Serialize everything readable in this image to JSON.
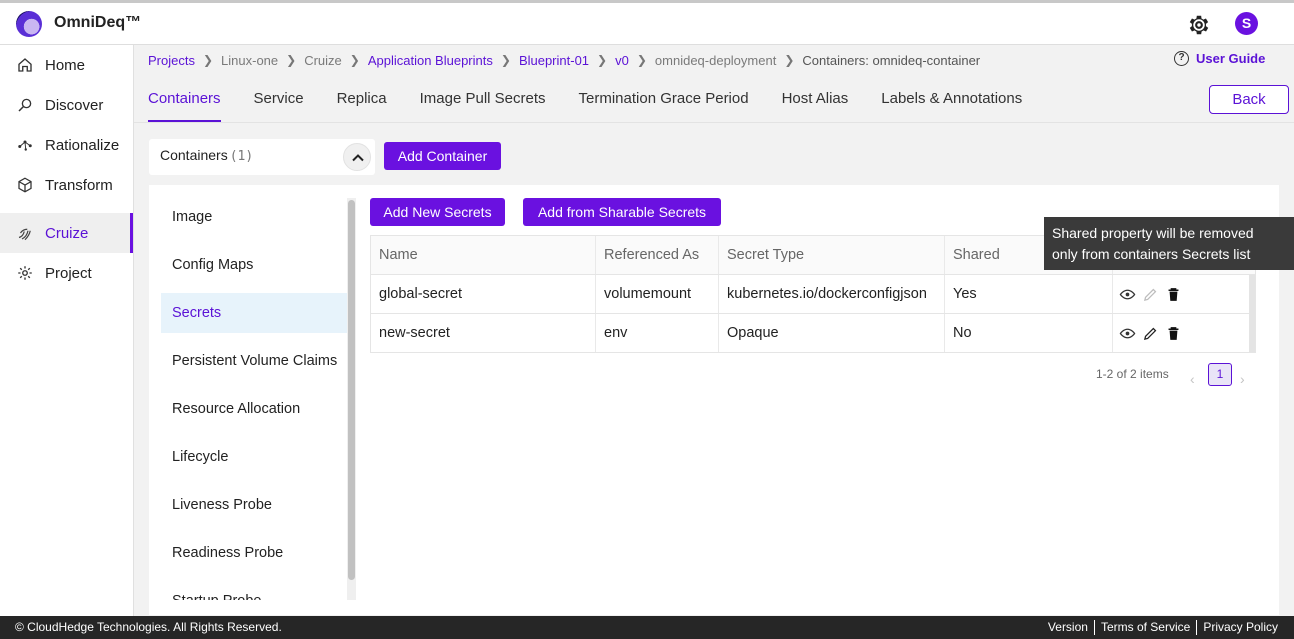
{
  "app": {
    "brand": "OmniDeq™",
    "user_initial": "S"
  },
  "sidebar": {
    "items": [
      {
        "label": "Home",
        "icon": "home-icon"
      },
      {
        "label": "Discover",
        "icon": "discover-icon"
      },
      {
        "label": "Rationalize",
        "icon": "rationalize-icon"
      },
      {
        "label": "Transform",
        "icon": "transform-icon"
      },
      {
        "label": "Cruize",
        "icon": "cruize-icon",
        "active": true
      },
      {
        "label": "Project",
        "icon": "project-icon"
      }
    ]
  },
  "breadcrumb": [
    {
      "label": "Projects",
      "style": "link"
    },
    {
      "label": "Linux-one",
      "style": "muted"
    },
    {
      "label": "Cruize",
      "style": "muted"
    },
    {
      "label": "Application Blueprints",
      "style": "link"
    },
    {
      "label": "Blueprint-01",
      "style": "link"
    },
    {
      "label": "v0",
      "style": "link"
    },
    {
      "label": "omnideq-deployment",
      "style": "muted"
    },
    {
      "label": "Containers: omnideq-container",
      "style": "current"
    }
  ],
  "user_guide": "User Guide",
  "tabs": [
    "Containers",
    "Service",
    "Replica",
    "Image Pull Secrets",
    "Termination Grace Period",
    "Host Alias",
    "Labels & Annotations"
  ],
  "back_label": "Back",
  "containers": {
    "label": "Containers",
    "count": "(1)",
    "add_label": "Add Container"
  },
  "subnav": [
    "Image",
    "Config Maps",
    "Secrets",
    "Persistent Volume Claims",
    "Resource Allocation",
    "Lifecycle",
    "Liveness Probe",
    "Readiness Probe",
    "Startup Probe"
  ],
  "subnav_active": "Secrets",
  "secrets": {
    "add_new": "Add New Secrets",
    "add_sharable": "Add from Sharable Secrets",
    "columns": [
      "Name",
      "Referenced As",
      "Secret Type",
      "Shared",
      ""
    ],
    "rows": [
      {
        "name": "global-secret",
        "referenced_as": "volumemount",
        "secret_type": "kubernetes.io/dockerconfigjson",
        "shared": "Yes"
      },
      {
        "name": "new-secret",
        "referenced_as": "env",
        "secret_type": "Opaque",
        "shared": "No"
      }
    ],
    "tooltip_line1": "Shared property will be removed",
    "tooltip_line2": "only from containers Secrets list"
  },
  "pagination": {
    "summary": "1-2 of 2 items",
    "current": "1",
    "prev": "‹",
    "next": "›"
  },
  "footer": {
    "copyright": "© CloudHedge Technologies. All Rights Reserved.",
    "links": [
      "Version",
      "Terms of Service",
      "Privacy Policy"
    ]
  },
  "colors": {
    "accent": "#6a11e0",
    "link": "#5b12d6"
  }
}
